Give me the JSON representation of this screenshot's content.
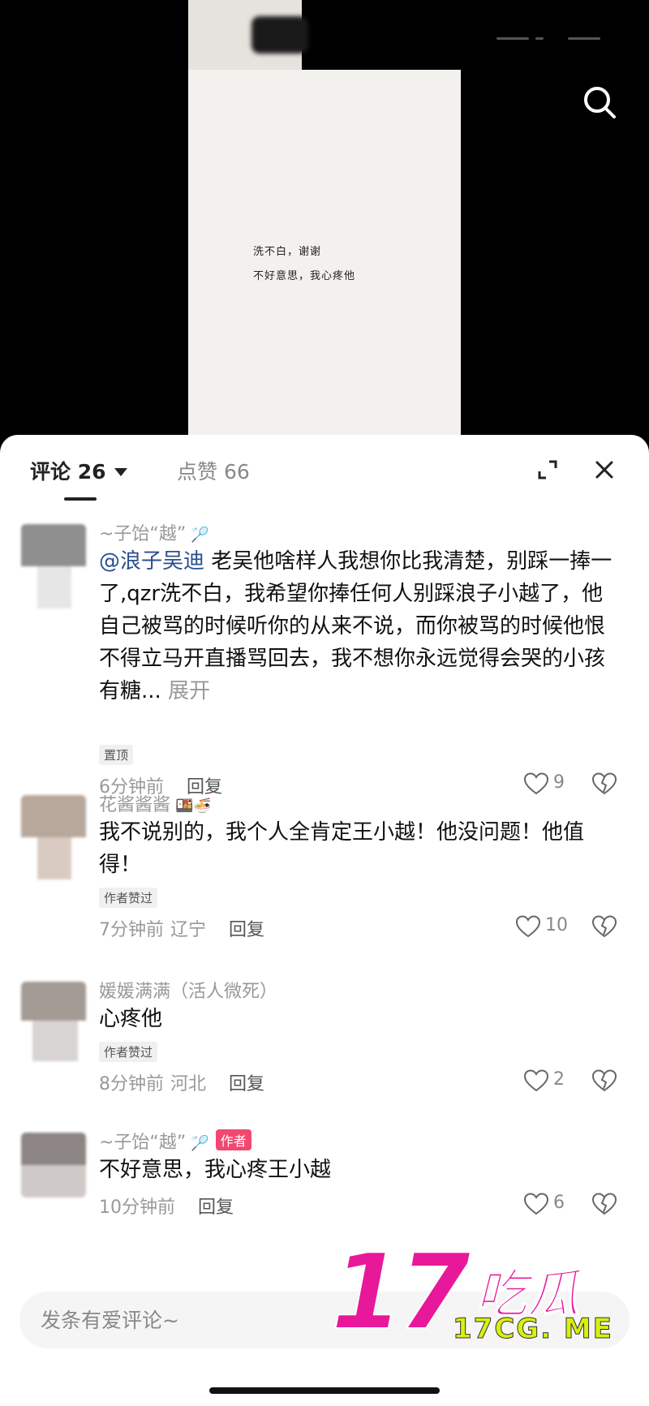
{
  "video": {
    "paper_lines": [
      "洗不白，谢谢",
      "不好意思，我心疼他"
    ],
    "search_icon": "search-icon"
  },
  "panel": {
    "tab_comments": "评论 26",
    "tab_likes": "点赞 66",
    "expand_icon": "expand-icon",
    "close_icon": "close-icon"
  },
  "comments": [
    {
      "username": "~子饴“越”",
      "mention": "@浪子吴迪",
      "body": " 老吴他啥样人我想你比我清楚，别踩一捧一了,qzr洗不白，我希望你捧任何人别踩浪子小越了，他自己被骂的时候听你的从来不说，而你被骂的时候他恨不得立马开直播骂回去，我不想你永远觉得会哭的小孩有糖...",
      "expand": "展开",
      "tag": "置顶",
      "time": "6分钟前",
      "location": "",
      "reply": "回复",
      "likes": "9"
    },
    {
      "username": "花酱酱酱",
      "body": "我不说别的，我个人全肯定王小越！他没问题！他值得！",
      "tag": "作者赞过",
      "time": "7分钟前",
      "location": "辽宁",
      "reply": "回复",
      "likes": "10"
    },
    {
      "username": "媛媛满满（活人微死）",
      "body": "心疼他",
      "tag": "作者赞过",
      "time": "8分钟前",
      "location": "河北",
      "reply": "回复",
      "likes": "2"
    },
    {
      "username": "~子饴“越”",
      "author_badge": "作者",
      "body": "不好意思，我心疼王小越",
      "time": "10分钟前",
      "location": "",
      "reply": "回复",
      "likes": "6"
    }
  ],
  "input": {
    "placeholder": "发条有爱评论~"
  },
  "watermark": {
    "number": "17",
    "chinese": "吃瓜",
    "url": "17CG. ME"
  },
  "colors": {
    "mention": "#2a4f8f",
    "author_badge": "#f2486f",
    "watermark": "#e8189a"
  }
}
